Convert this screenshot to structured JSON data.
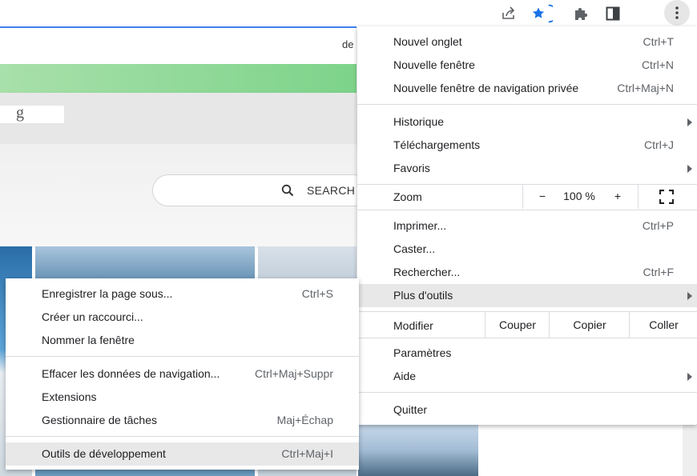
{
  "page": {
    "partial_text": "de",
    "search_label": "SEARCH",
    "hidden_glyph": "g"
  },
  "main_menu": {
    "group1": [
      {
        "label": "Nouvel onglet",
        "shortcut": "Ctrl+T"
      },
      {
        "label": "Nouvelle fenêtre",
        "shortcut": "Ctrl+N"
      },
      {
        "label": "Nouvelle fenêtre de navigation privée",
        "shortcut": "Ctrl+Maj+N"
      }
    ],
    "group2": [
      {
        "label": "Historique",
        "shortcut": ""
      },
      {
        "label": "Téléchargements",
        "shortcut": "Ctrl+J"
      },
      {
        "label": "Favoris",
        "shortcut": ""
      }
    ],
    "zoom": {
      "label": "Zoom",
      "minus": "−",
      "value": "100 %",
      "plus": "+"
    },
    "group3": [
      {
        "label": "Imprimer...",
        "shortcut": "Ctrl+P"
      },
      {
        "label": "Caster...",
        "shortcut": ""
      },
      {
        "label": "Rechercher...",
        "shortcut": "Ctrl+F"
      },
      {
        "label": "Plus d'outils",
        "shortcut": ""
      }
    ],
    "edit": {
      "label": "Modifier",
      "cut": "Couper",
      "copy": "Copier",
      "paste": "Coller"
    },
    "group4": [
      {
        "label": "Paramètres",
        "shortcut": ""
      },
      {
        "label": "Aide",
        "shortcut": ""
      }
    ],
    "quit": {
      "label": "Quitter"
    }
  },
  "submenu": {
    "group1": [
      {
        "label": "Enregistrer la page sous...",
        "shortcut": "Ctrl+S"
      },
      {
        "label": "Créer un raccourci...",
        "shortcut": ""
      },
      {
        "label": "Nommer la fenêtre",
        "shortcut": ""
      }
    ],
    "group2": [
      {
        "label": "Effacer les données de navigation...",
        "shortcut": "Ctrl+Maj+Suppr"
      },
      {
        "label": "Extensions",
        "shortcut": ""
      },
      {
        "label": "Gestionnaire de tâches",
        "shortcut": "Maj+Échap"
      }
    ],
    "group3": [
      {
        "label": "Outils de développement",
        "shortcut": "Ctrl+Maj+I"
      }
    ]
  },
  "icons": {
    "share": "share-icon",
    "star": "star-icon",
    "extensions": "puzzle-icon",
    "side_panel": "side-panel-icon",
    "menu": "kebab-menu-icon",
    "fullscreen": "fullscreen-icon",
    "search": "search-icon"
  },
  "colors": {
    "accent": "#1a73e8",
    "highlight": "#e8e8e8",
    "separator": "#dadce0"
  }
}
